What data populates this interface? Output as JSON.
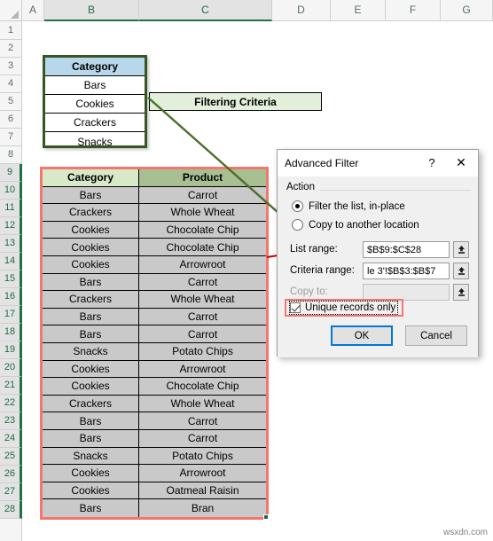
{
  "spreadsheet": {
    "columns": [
      {
        "label": "A",
        "selected": false
      },
      {
        "label": "B",
        "selected": true
      },
      {
        "label": "C",
        "selected": true
      },
      {
        "label": "D",
        "selected": false
      },
      {
        "label": "E",
        "selected": false
      },
      {
        "label": "F",
        "selected": false
      },
      {
        "label": "G",
        "selected": false
      }
    ],
    "rows": [
      "1",
      "2",
      "3",
      "4",
      "5",
      "6",
      "7",
      "8",
      "9",
      "10",
      "11",
      "12",
      "13",
      "14",
      "15",
      "16",
      "17",
      "18",
      "19",
      "20",
      "21",
      "22",
      "23",
      "24",
      "25",
      "26",
      "27",
      "28"
    ],
    "selected_rows": [
      "9",
      "10",
      "11",
      "12",
      "13",
      "14",
      "15",
      "16",
      "17",
      "18",
      "19",
      "20",
      "21",
      "22",
      "23",
      "24",
      "25",
      "26",
      "27",
      "28"
    ]
  },
  "criteria_table": {
    "header": "Category",
    "values": [
      "Bars",
      "Cookies",
      "Crackers",
      "Snacks"
    ],
    "header_fill": "#b9d7ea",
    "border_color": "#375623"
  },
  "callout": {
    "label": "Filtering Criteria",
    "fill": "#e2efda"
  },
  "data_table": {
    "headers": [
      "Category",
      "Product"
    ],
    "header_fill_category": "#d8e9c8",
    "header_fill_product": "#a8bf91",
    "cell_fill": "#c9c9c9",
    "selection_border": "#f4776e",
    "rows": [
      {
        "category": "Bars",
        "product": "Carrot"
      },
      {
        "category": "Crackers",
        "product": "Whole Wheat"
      },
      {
        "category": "Cookies",
        "product": "Chocolate Chip"
      },
      {
        "category": "Cookies",
        "product": "Chocolate Chip"
      },
      {
        "category": "Cookies",
        "product": "Arrowroot"
      },
      {
        "category": "Bars",
        "product": "Carrot"
      },
      {
        "category": "Crackers",
        "product": "Whole Wheat"
      },
      {
        "category": "Bars",
        "product": "Carrot"
      },
      {
        "category": "Bars",
        "product": "Carrot"
      },
      {
        "category": "Snacks",
        "product": "Potato Chips"
      },
      {
        "category": "Cookies",
        "product": "Arrowroot"
      },
      {
        "category": "Cookies",
        "product": "Chocolate Chip"
      },
      {
        "category": "Crackers",
        "product": "Whole Wheat"
      },
      {
        "category": "Bars",
        "product": "Carrot"
      },
      {
        "category": "Bars",
        "product": "Carrot"
      },
      {
        "category": "Snacks",
        "product": "Potato Chips"
      },
      {
        "category": "Cookies",
        "product": "Arrowroot"
      },
      {
        "category": "Cookies",
        "product": "Oatmeal Raisin"
      },
      {
        "category": "Bars",
        "product": "Bran"
      }
    ]
  },
  "dialog": {
    "title": "Advanced Filter",
    "help_label": "?",
    "close_label": "✕",
    "action_group_label": "Action",
    "radio_filter_in_place": "Filter the list, in-place",
    "radio_copy_another": "Copy to another location",
    "radio_selected": "filter_in_place",
    "list_range_label": "List range:",
    "list_range_value": "$B$9:$C$28",
    "criteria_range_label": "Criteria range:",
    "criteria_range_value": "le 3'!$B$3:$B$7",
    "copy_to_label": "Copy to:",
    "copy_to_value": "",
    "unique_records_label": "Unique records only",
    "unique_records_checked": true,
    "ok_label": "OK",
    "cancel_label": "Cancel",
    "picker_icon": "range-picker-icon"
  },
  "annotations": {
    "red_arrow_target": "list-range-input",
    "green_arrow_target": "criteria-range-input",
    "red_color": "#c00000",
    "green_color": "#4a6e28"
  },
  "watermark": "wsxdn.com"
}
